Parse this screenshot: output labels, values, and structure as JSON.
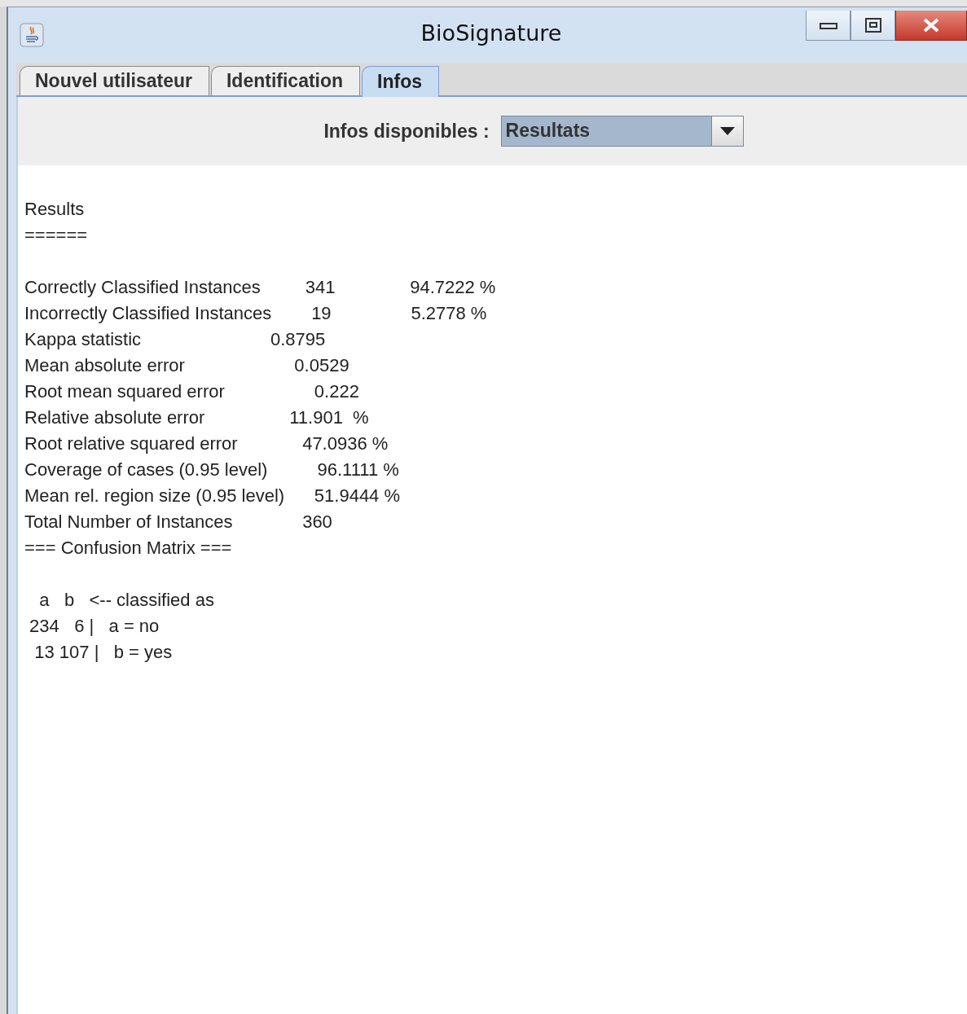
{
  "window": {
    "title": "BioSignature"
  },
  "tabs": [
    {
      "label": "Nouvel utilisateur",
      "selected": false
    },
    {
      "label": "Identification",
      "selected": false
    },
    {
      "label": "Infos",
      "selected": true
    }
  ],
  "selector": {
    "label": "Infos disponibles :",
    "value": "Resultats"
  },
  "output_blocks": [
    {
      "lines": [
        "Results",
        "======"
      ]
    },
    {
      "lines": [
        "Correctly Classified Instances         341               94.7222 %",
        "Incorrectly Classified Instances        19                5.2778 %",
        "Kappa statistic                          0.8795",
        "Mean absolute error                      0.0529",
        "Root mean squared error                  0.222",
        "Relative absolute error                 11.901  %",
        "Root relative squared error             47.0936 %",
        "Coverage of cases (0.95 level)          96.1111 %",
        "Mean rel. region size (0.95 level)      51.9444 %",
        "Total Number of Instances              360",
        "=== Confusion Matrix ==="
      ]
    },
    {
      "lines": [
        "   a   b   <-- classified as",
        " 234   6 |   a = no",
        "  13 107 |   b = yes"
      ]
    }
  ]
}
